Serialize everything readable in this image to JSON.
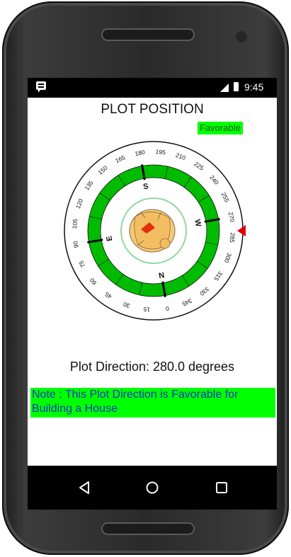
{
  "status_bar": {
    "time": "9:45",
    "icons": [
      "message-icon",
      "signal-icon",
      "battery-icon"
    ]
  },
  "app": {
    "title": "PLOT POSITION",
    "badge": "Favorable",
    "badge_color": "#00ff00",
    "plot_direction_text": "Plot Direction: 280.0 degrees",
    "note": "Note : This Plot Direction is Favorable for Building a House",
    "note_text_color": "#1034c8"
  },
  "compass": {
    "degree_labels": [
      "0",
      "15",
      "30",
      "45",
      "60",
      "75",
      "90",
      "105",
      "120",
      "135",
      "150",
      "165",
      "180",
      "195",
      "210",
      "225",
      "240",
      "255",
      "270",
      "285",
      "300",
      "315",
      "330",
      "345"
    ],
    "cardinals": {
      "n": "N",
      "e": "E",
      "s": "S",
      "w": "W"
    },
    "plot_direction_degrees": 280,
    "ring_color": "#00bb00",
    "pointer_color": "#e00000"
  },
  "nav_bar": {
    "buttons": [
      "back",
      "home",
      "recent-apps"
    ]
  }
}
